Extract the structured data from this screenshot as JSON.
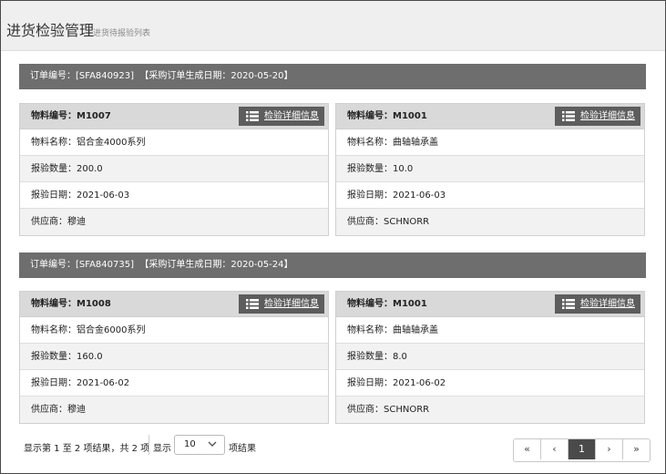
{
  "header": {
    "title": "进货检验管理",
    "subtitle": "进货待报验列表"
  },
  "detail_label": "检验详细信息",
  "orders": [
    {
      "header": "订单编号：[SFA840923]  【采购订单生成日期：2020-05-20】",
      "items": [
        {
          "code": "物料编号：M1007",
          "name": "物料名称：铝合金4000系列",
          "qty": "报验数量：200.0",
          "date": "报验日期：2021-06-03",
          "supplier": "供应商：穆迪"
        },
        {
          "code": "物料编号：M1001",
          "name": "物料名称：曲轴轴承盖",
          "qty": "报验数量：10.0",
          "date": "报验日期：2021-06-03",
          "supplier": "供应商：SCHNORR"
        }
      ]
    },
    {
      "header": "订单编号：[SFA840735]  【采购订单生成日期：2020-05-24】",
      "items": [
        {
          "code": "物料编号：M1008",
          "name": "物料名称：铝合金6000系列",
          "qty": "报验数量：160.0",
          "date": "报验日期：2021-06-02",
          "supplier": "供应商：穆迪"
        },
        {
          "code": "物料编号：M1001",
          "name": "物料名称：曲轴轴承盖",
          "qty": "报验数量：8.0",
          "date": "报验日期：2021-06-02",
          "supplier": "供应商：SCHNORR"
        }
      ]
    }
  ],
  "footer": {
    "info": "显示第 1 至 2 项结果，共 2 项",
    "show_label": "显示",
    "page_size": "10",
    "results_label": "项结果"
  },
  "pagination": {
    "first": "«",
    "prev": "‹",
    "current": "1",
    "next": "›",
    "last": "»"
  }
}
